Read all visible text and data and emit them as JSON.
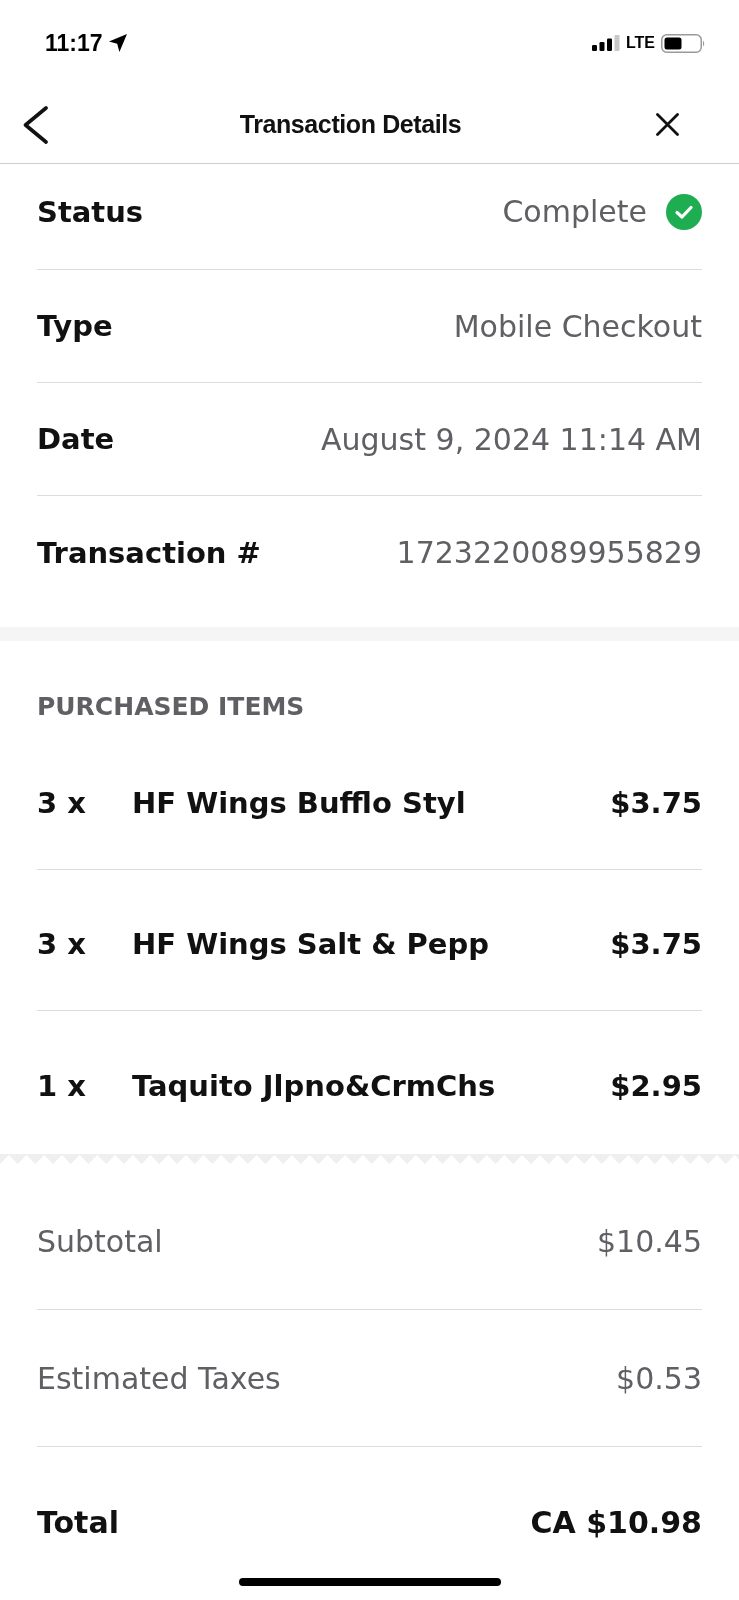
{
  "status_bar": {
    "time": "11:17",
    "network": "LTE"
  },
  "header": {
    "title": "Transaction Details"
  },
  "details": [
    {
      "kind": "status",
      "label": "Status",
      "value": "Complete"
    },
    {
      "kind": "text",
      "label": "Type",
      "value": "Mobile Checkout"
    },
    {
      "kind": "text",
      "label": "Date",
      "value": "August 9, 2024 11:14 AM"
    },
    {
      "kind": "text",
      "label": "Transaction #",
      "value": "1723220089955829"
    }
  ],
  "purchased_items": {
    "heading": "PURCHASED ITEMS",
    "items": [
      {
        "quantity": "3 x",
        "name": "HF Wings Bufflo Styl",
        "price": "$3.75"
      },
      {
        "quantity": "3 x",
        "name": "HF Wings Salt & Pepp",
        "price": "$3.75"
      },
      {
        "quantity": "1 x",
        "name": "Taquito Jlpno&CrmChs",
        "price": "$2.95"
      }
    ]
  },
  "summary": [
    {
      "kind": "line",
      "label": "Subtotal",
      "value": "$10.45"
    },
    {
      "kind": "line",
      "label": "Estimated Taxes",
      "value": "$0.53"
    },
    {
      "kind": "total",
      "label": "Total",
      "value": "CA $10.98"
    }
  ]
}
